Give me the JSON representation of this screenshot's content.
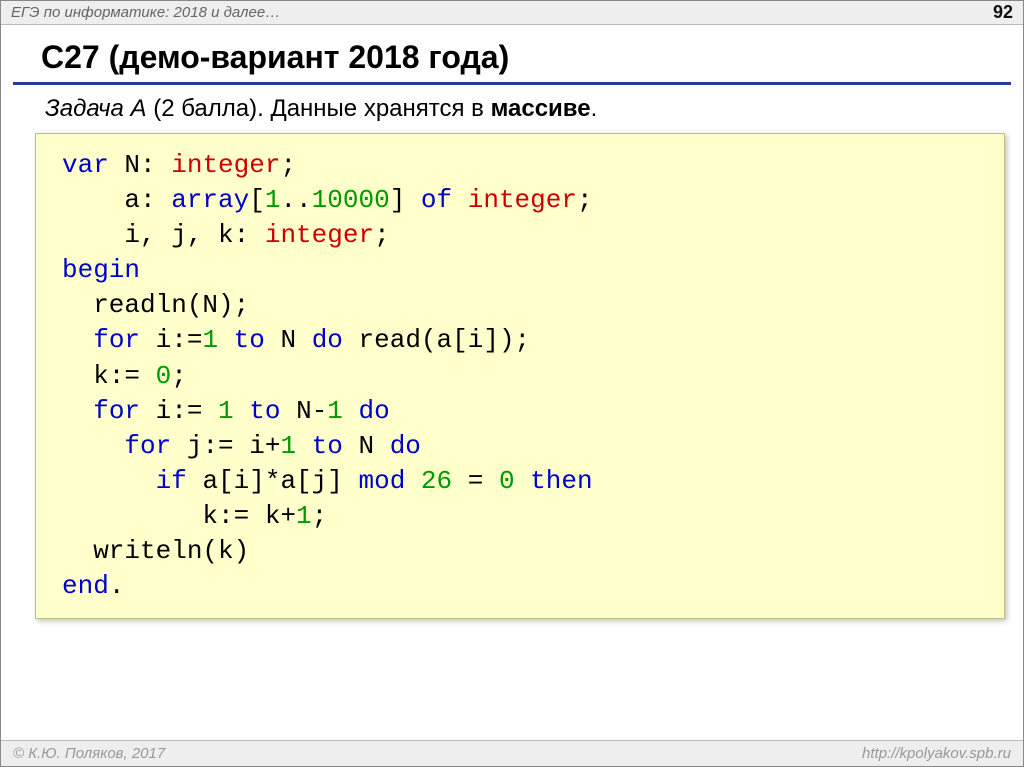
{
  "header": {
    "subject": "ЕГЭ по информатике: 2018 и далее…",
    "page": "92"
  },
  "title": "C27 (демо-вариант 2018 года)",
  "task": {
    "label": "Задача А",
    "points": " (2 балла). ",
    "text_prefix": "Данные хранятся в ",
    "bold": "массиве",
    "suffix": "."
  },
  "code": {
    "kw": {
      "var": "var",
      "array": "array",
      "of": "of",
      "begin": "begin",
      "for": "for",
      "to": "to",
      "do": "do",
      "if": "if",
      "mod": "mod",
      "then": "then",
      "end": "end"
    },
    "ty": {
      "integer": "integer"
    },
    "nums": {
      "one": "1",
      "tenk": "10000",
      "zero": "0",
      "n26": "26"
    },
    "plain_source": "var N: integer;\n    a: array[1..10000] of integer;\n    i, j, k: integer;\nbegin\n  readln(N);\n  for i:=1 to N do read(a[i]);\n  k:= 0;\n  for i:= 1 to N-1 do\n    for j:= i+1 to N do\n      if a[i]*a[j] mod 26 = 0 then\n         k:= k+1;\n  writeln(k)\nend."
  },
  "footer": {
    "copyright": "© К.Ю. Поляков, 2017",
    "url": "http://kpolyakov.spb.ru"
  }
}
